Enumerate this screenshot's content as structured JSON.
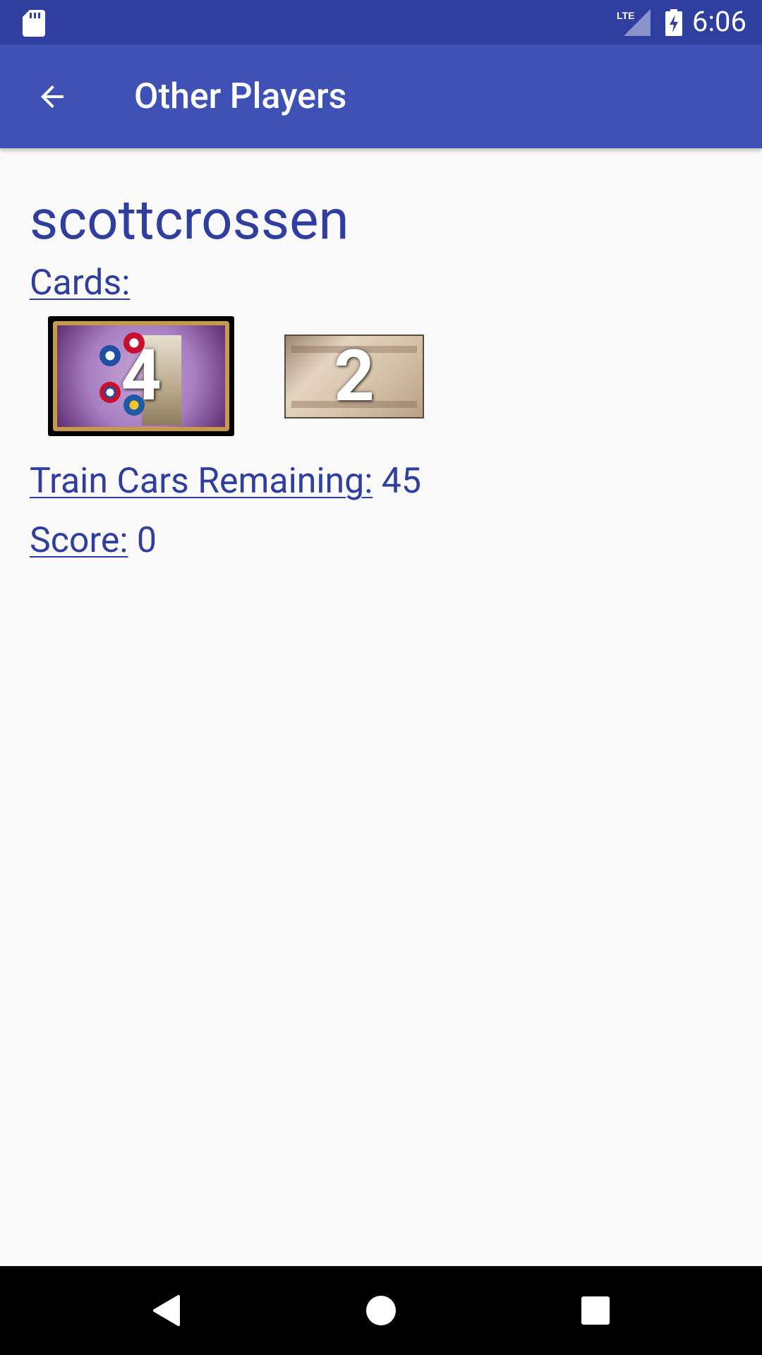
{
  "status_bar": {
    "sd_card_icon": "sd-card-icon",
    "network": "LTE",
    "battery_icon": "battery-charging-icon",
    "time": "6:06"
  },
  "app_bar": {
    "back_icon": "arrow-back-icon",
    "title": "Other Players"
  },
  "player": {
    "name": "scottcrossen",
    "cards_label": "Cards:",
    "cards": [
      {
        "kind": "train-card",
        "count": "4"
      },
      {
        "kind": "destination-ticket",
        "count": "2"
      }
    ],
    "train_cars_label": "Train Cars Remaining:",
    "train_cars_value": "45",
    "score_label": "Score:",
    "score_value": "0"
  },
  "colors": {
    "status_bar": "#303f9f",
    "app_bar": "#3f51b5",
    "text": "#303f9f",
    "background": "#fafafa"
  },
  "nav_bar": {
    "back_icon": "nav-back-icon",
    "home_icon": "nav-home-icon",
    "recents_icon": "nav-recents-icon"
  }
}
